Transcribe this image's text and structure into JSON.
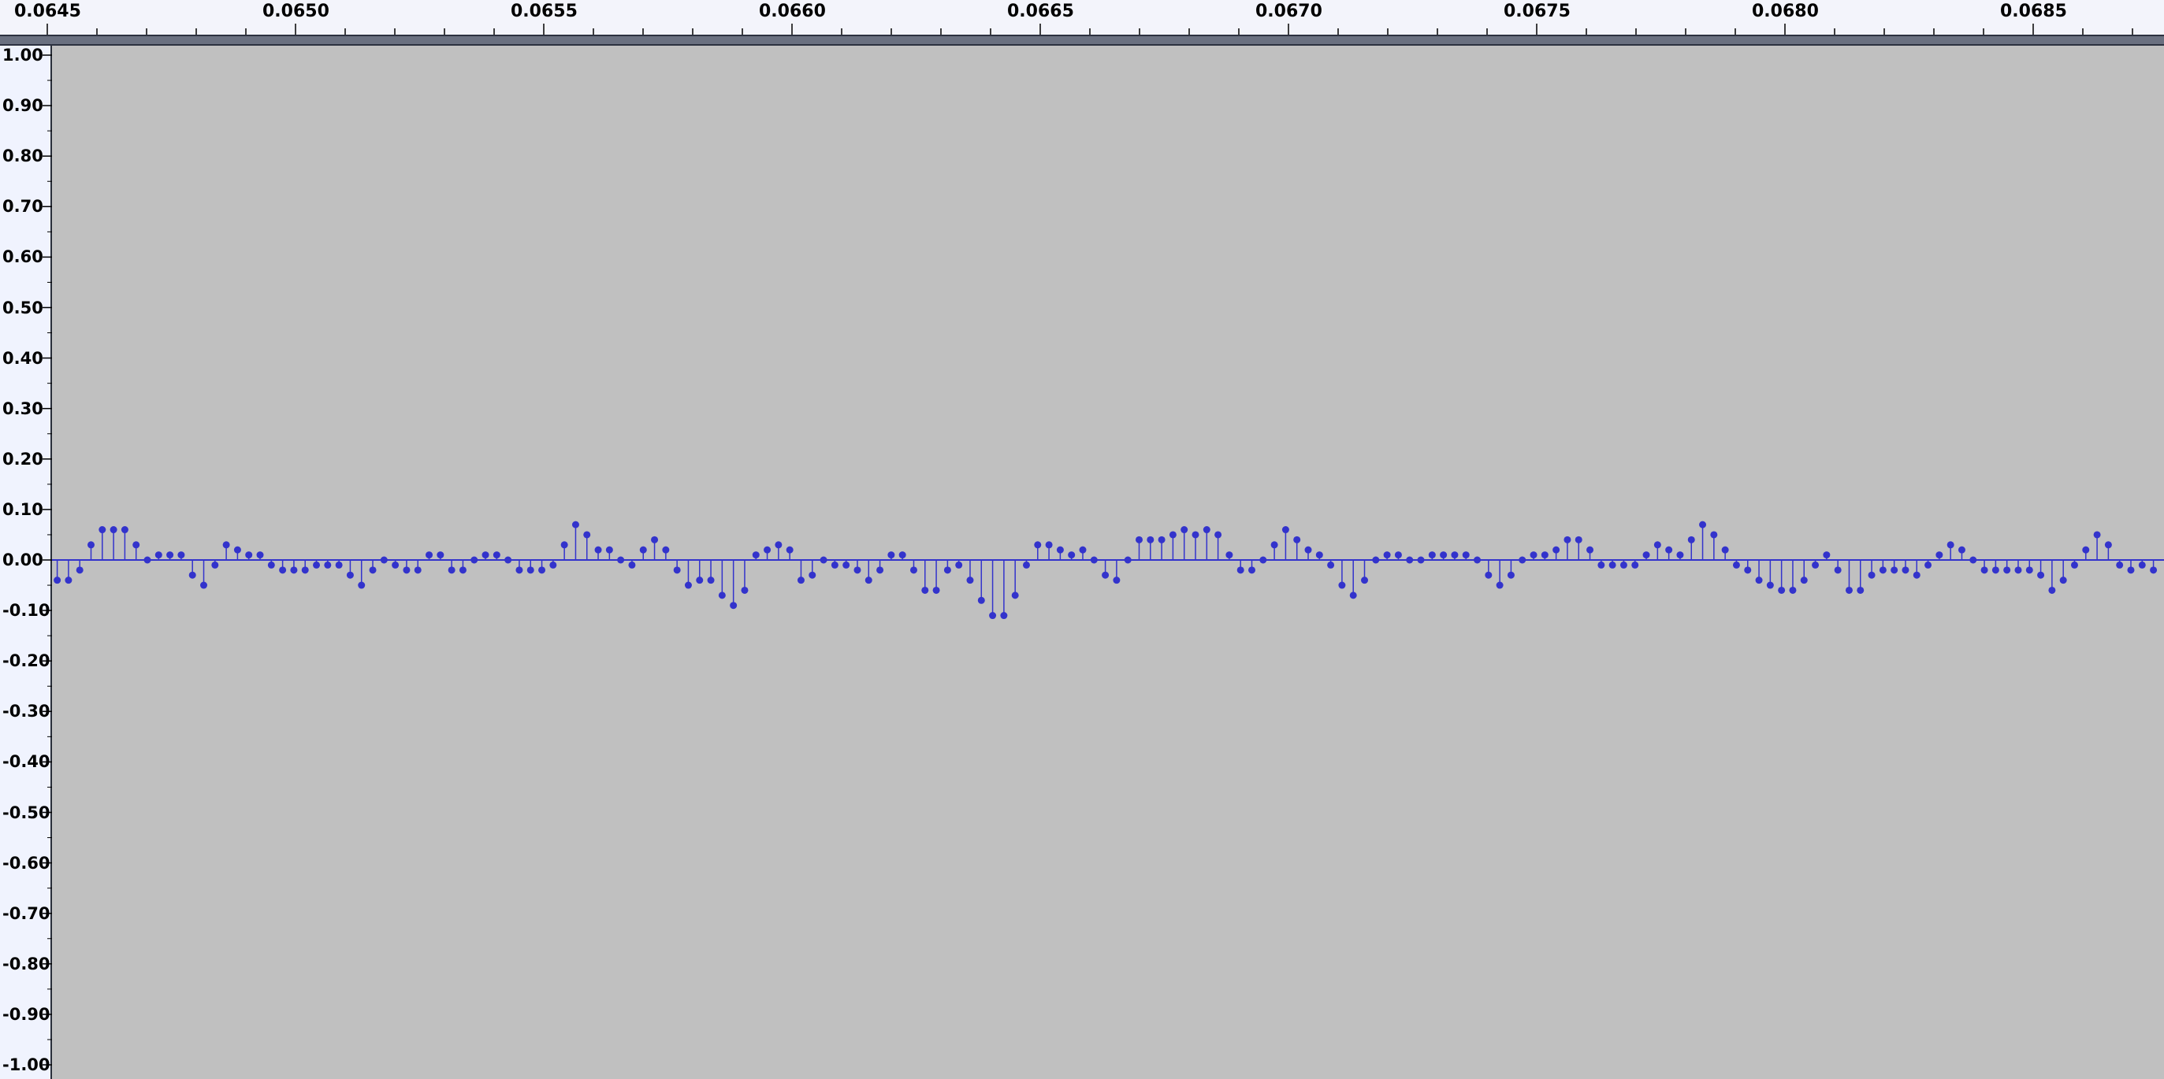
{
  "timeline": {
    "labels": [
      "0.0645",
      "0.0650",
      "0.0655",
      "0.0660",
      "0.0665",
      "0.0670",
      "0.0675",
      "0.0680",
      "0.0685"
    ],
    "start": 0.0645,
    "end": 0.06873,
    "major_step": 0.0005,
    "minor_step": 0.0001
  },
  "amplitude_ruler": {
    "labels": [
      "1.00",
      "0.90",
      "0.80",
      "0.70",
      "0.60",
      "0.50",
      "0.40",
      "0.30",
      "0.20",
      "0.10",
      "0.00",
      "-0.10",
      "-0.20",
      "-0.30",
      "-0.40",
      "-0.50",
      "-0.60",
      "-0.70",
      "-0.80",
      "-0.90",
      "-1.00"
    ],
    "max": 1.0,
    "min": -1.0
  },
  "waveform": {
    "style": "stem",
    "color": "#3333cc",
    "sample_start_time": 0.06452,
    "sample_interval": 2.27e-05,
    "samples": [
      -0.04,
      -0.04,
      -0.02,
      0.03,
      0.06,
      0.06,
      0.06,
      0.03,
      0.0,
      0.01,
      0.01,
      0.01,
      -0.03,
      -0.05,
      -0.01,
      0.03,
      0.02,
      0.01,
      0.01,
      -0.01,
      -0.02,
      -0.02,
      -0.02,
      -0.01,
      -0.01,
      -0.01,
      -0.03,
      -0.05,
      -0.02,
      0.0,
      -0.01,
      -0.02,
      -0.02,
      0.01,
      0.01,
      -0.02,
      -0.02,
      0.0,
      0.01,
      0.01,
      0.0,
      -0.02,
      -0.02,
      -0.02,
      -0.01,
      0.03,
      0.07,
      0.05,
      0.02,
      0.02,
      0.0,
      -0.01,
      0.02,
      0.04,
      0.02,
      -0.02,
      -0.05,
      -0.04,
      -0.04,
      -0.07,
      -0.09,
      -0.06,
      0.01,
      0.02,
      0.03,
      0.02,
      -0.04,
      -0.03,
      0.0,
      -0.01,
      -0.01,
      -0.02,
      -0.04,
      -0.02,
      0.01,
      0.01,
      -0.02,
      -0.06,
      -0.06,
      -0.02,
      -0.01,
      -0.04,
      -0.08,
      -0.11,
      -0.11,
      -0.07,
      -0.01,
      0.03,
      0.03,
      0.02,
      0.01,
      0.02,
      0.0,
      -0.03,
      -0.04,
      0.0,
      0.04,
      0.04,
      0.04,
      0.05,
      0.06,
      0.05,
      0.06,
      0.05,
      0.01,
      -0.02,
      -0.02,
      0.0,
      0.03,
      0.06,
      0.04,
      0.02,
      0.01,
      -0.01,
      -0.05,
      -0.07,
      -0.04,
      0.0,
      0.01,
      0.01,
      0.0,
      0.0,
      0.01,
      0.01,
      0.01,
      0.01,
      0.0,
      -0.03,
      -0.05,
      -0.03,
      0.0,
      0.01,
      0.01,
      0.02,
      0.04,
      0.04,
      0.02,
      -0.01,
      -0.01,
      -0.01,
      -0.01,
      0.01,
      0.03,
      0.02,
      0.01,
      0.04,
      0.07,
      0.05,
      0.02,
      -0.01,
      -0.02,
      -0.04,
      -0.05,
      -0.06,
      -0.06,
      -0.04,
      -0.01,
      0.01,
      -0.02,
      -0.06,
      -0.06,
      -0.03,
      -0.02,
      -0.02,
      -0.02,
      -0.03,
      -0.01,
      0.01,
      0.03,
      0.02,
      0.0,
      -0.02,
      -0.02,
      -0.02,
      -0.02,
      -0.02,
      -0.03,
      -0.06,
      -0.04,
      -0.01,
      0.02,
      0.05,
      0.03,
      -0.01,
      -0.02,
      -0.01,
      -0.02
    ]
  }
}
